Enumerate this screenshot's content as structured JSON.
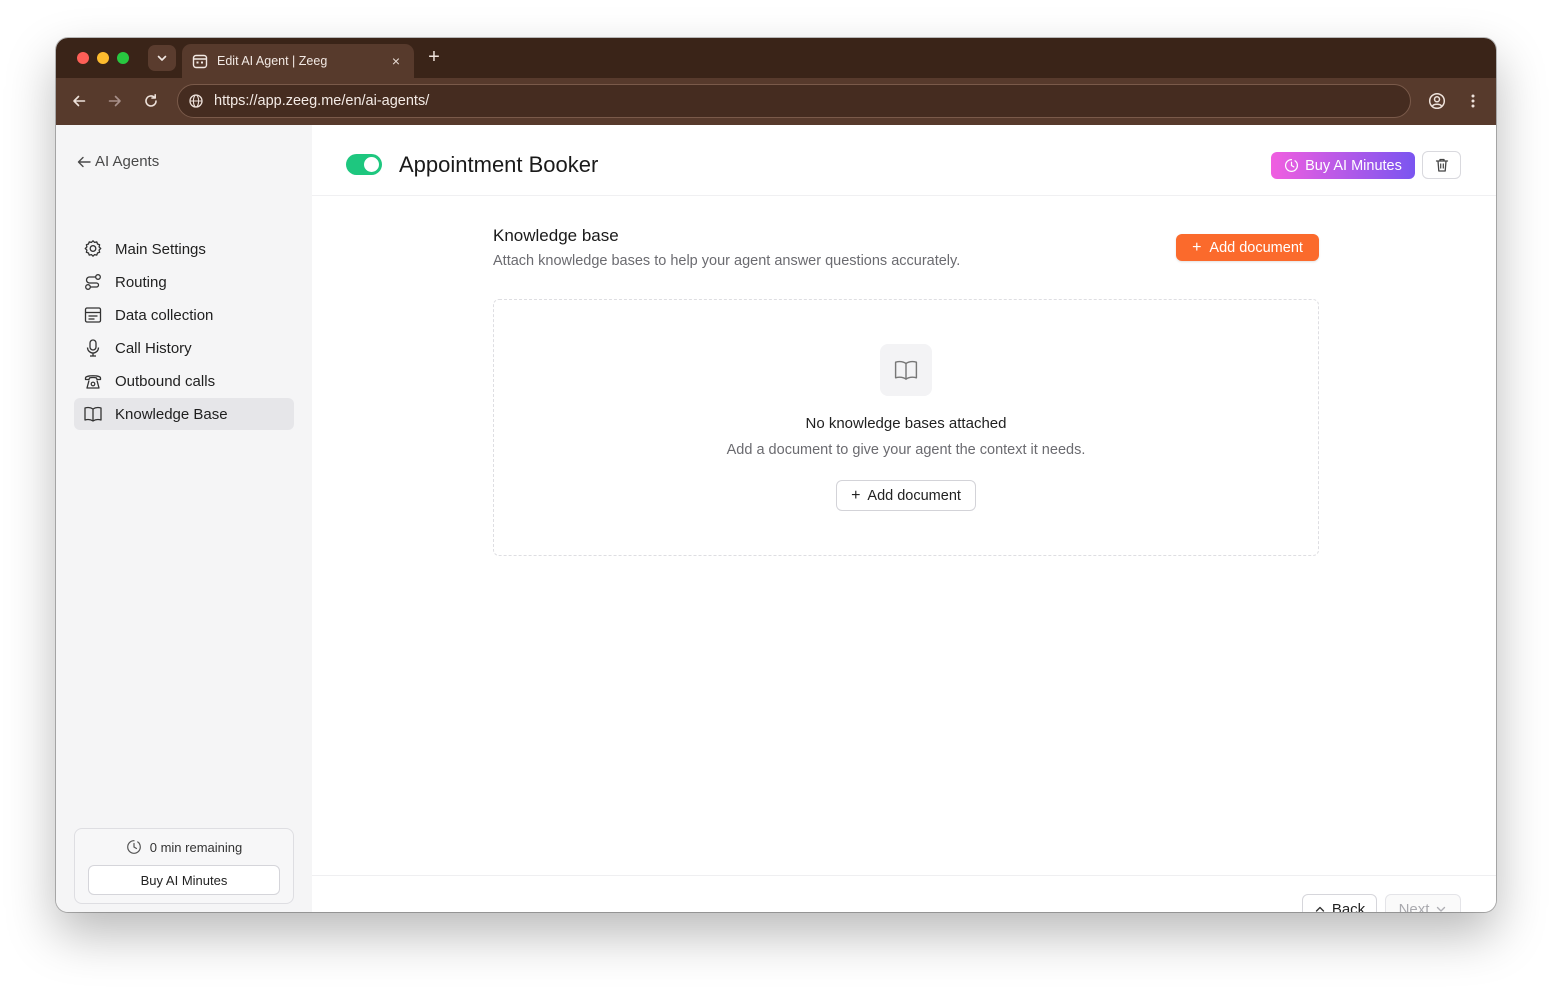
{
  "browser": {
    "tab_title": "Edit AI Agent | Zeeg",
    "tab_close": "×",
    "new_tab": "+",
    "url": "https://app.zeeg.me/en/ai-agents/"
  },
  "sidebar": {
    "back_label": "AI Agents",
    "items": [
      {
        "label": "Main Settings",
        "icon": "gear-icon"
      },
      {
        "label": "Routing",
        "icon": "routing-icon"
      },
      {
        "label": "Data collection",
        "icon": "form-icon"
      },
      {
        "label": "Call History",
        "icon": "microphone-icon"
      },
      {
        "label": "Outbound calls",
        "icon": "phone-icon"
      },
      {
        "label": "Knowledge Base",
        "icon": "book-icon",
        "active": true
      }
    ],
    "minutes_remaining": "0 min remaining",
    "buy_button": "Buy AI Minutes"
  },
  "header": {
    "title": "Appointment Booker",
    "toggle_on": true,
    "buy_minutes": "Buy AI Minutes"
  },
  "knowledge": {
    "title": "Knowledge base",
    "description": "Attach knowledge bases to help your agent answer questions accurately.",
    "add_document": "Add document",
    "empty_title": "No knowledge bases attached",
    "empty_description": "Add a document to give your agent the context it needs.",
    "empty_add_document": "Add document"
  },
  "footer": {
    "back": "Back",
    "next": "Next"
  },
  "colors": {
    "accent_orange": "#fb6a2c",
    "toggle_green": "#1ec77f",
    "gradient_start": "#f05ee0",
    "gradient_end": "#7a55f0",
    "chrome_dark": "#3a2418",
    "chrome_toolbar": "#573a2c"
  }
}
